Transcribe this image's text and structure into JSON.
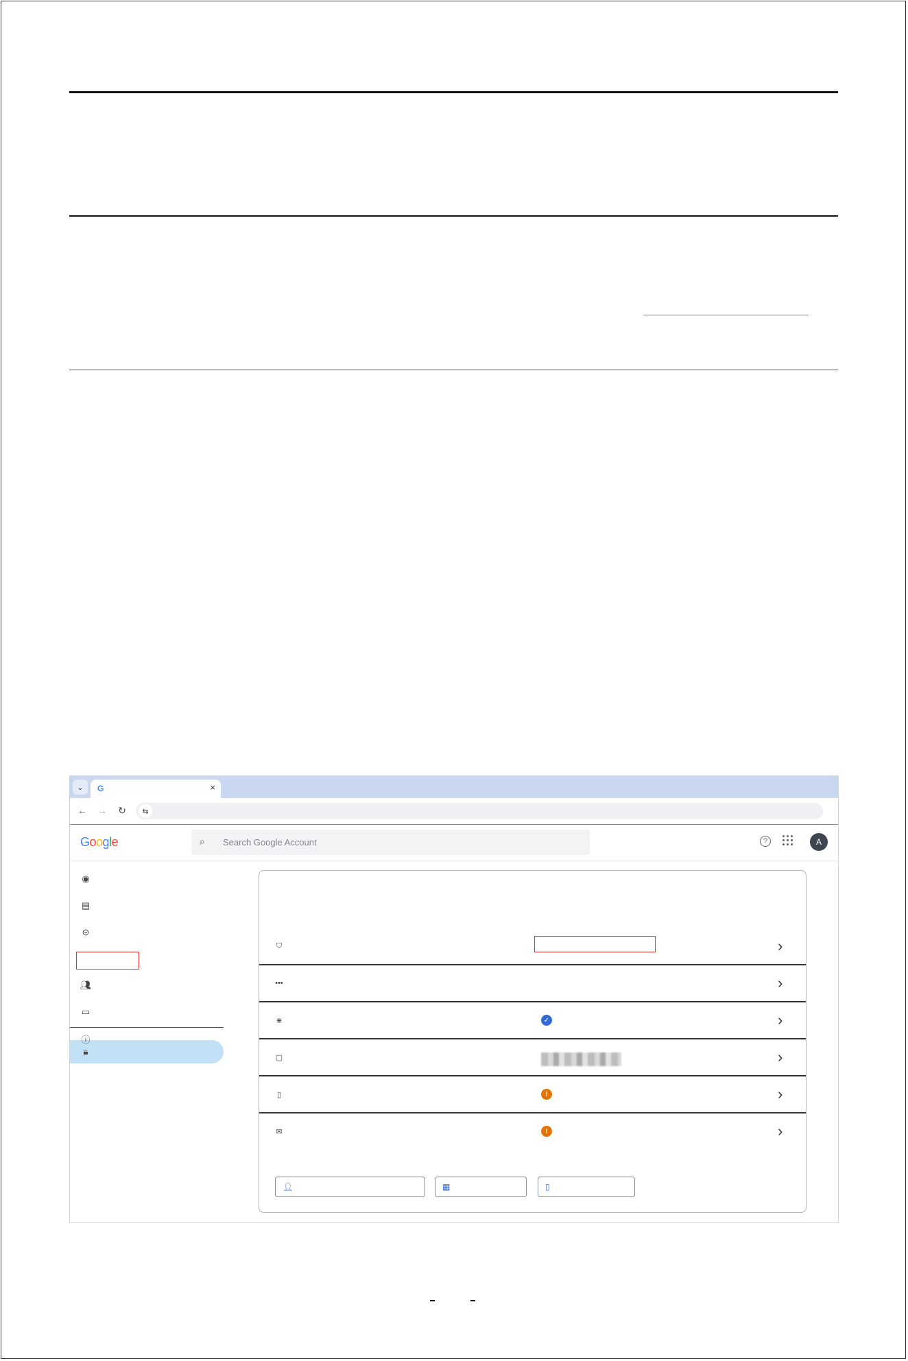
{
  "browser": {
    "tab_favicon": "G",
    "tab_close": "×",
    "dropdown_icon": "chevron-down-icon",
    "nav_icons": [
      "back-arrow-icon",
      "forward-arrow-icon",
      "reload-icon",
      "site-settings-icon"
    ]
  },
  "header": {
    "logo": {
      "G": "G",
      "o1": "o",
      "o2": "o",
      "g": "g",
      "l": "l",
      "e": "e"
    },
    "search_placeholder": "Search Google Account",
    "avatar_letter": "A"
  },
  "sidebar": {
    "items": [
      {
        "icon": "home-icon"
      },
      {
        "icon": "personal-info-icon"
      },
      {
        "icon": "data-privacy-icon"
      },
      {
        "icon": "security-lock-icon",
        "active": true
      },
      {
        "icon": "people-sharing-icon"
      },
      {
        "icon": "payments-icon"
      },
      {
        "icon": "about-icon"
      }
    ]
  },
  "card": {
    "rows": [
      {
        "icon": "shield-icon",
        "status": "highlighted"
      },
      {
        "icon": "password-icon",
        "status": "none"
      },
      {
        "icon": "skip-password-icon",
        "status": "ok",
        "status_glyph": "✓"
      },
      {
        "icon": "sms-icon",
        "status": "blurred"
      },
      {
        "icon": "phone-prompt-icon",
        "status": "warning",
        "status_glyph": "!"
      },
      {
        "icon": "email-icon",
        "status": "warning",
        "status_glyph": "!"
      }
    ],
    "chips": [
      {
        "icon": "add-person-icon"
      },
      {
        "icon": "qr-code-icon"
      },
      {
        "icon": "phone-icon"
      }
    ]
  },
  "colors": {
    "tab_bar": "#c9d8f0",
    "active_nav": "#c2e0f5",
    "highlight_box": "#e03030",
    "ok_status": "#3367d6",
    "warn_status": "#e37400"
  }
}
